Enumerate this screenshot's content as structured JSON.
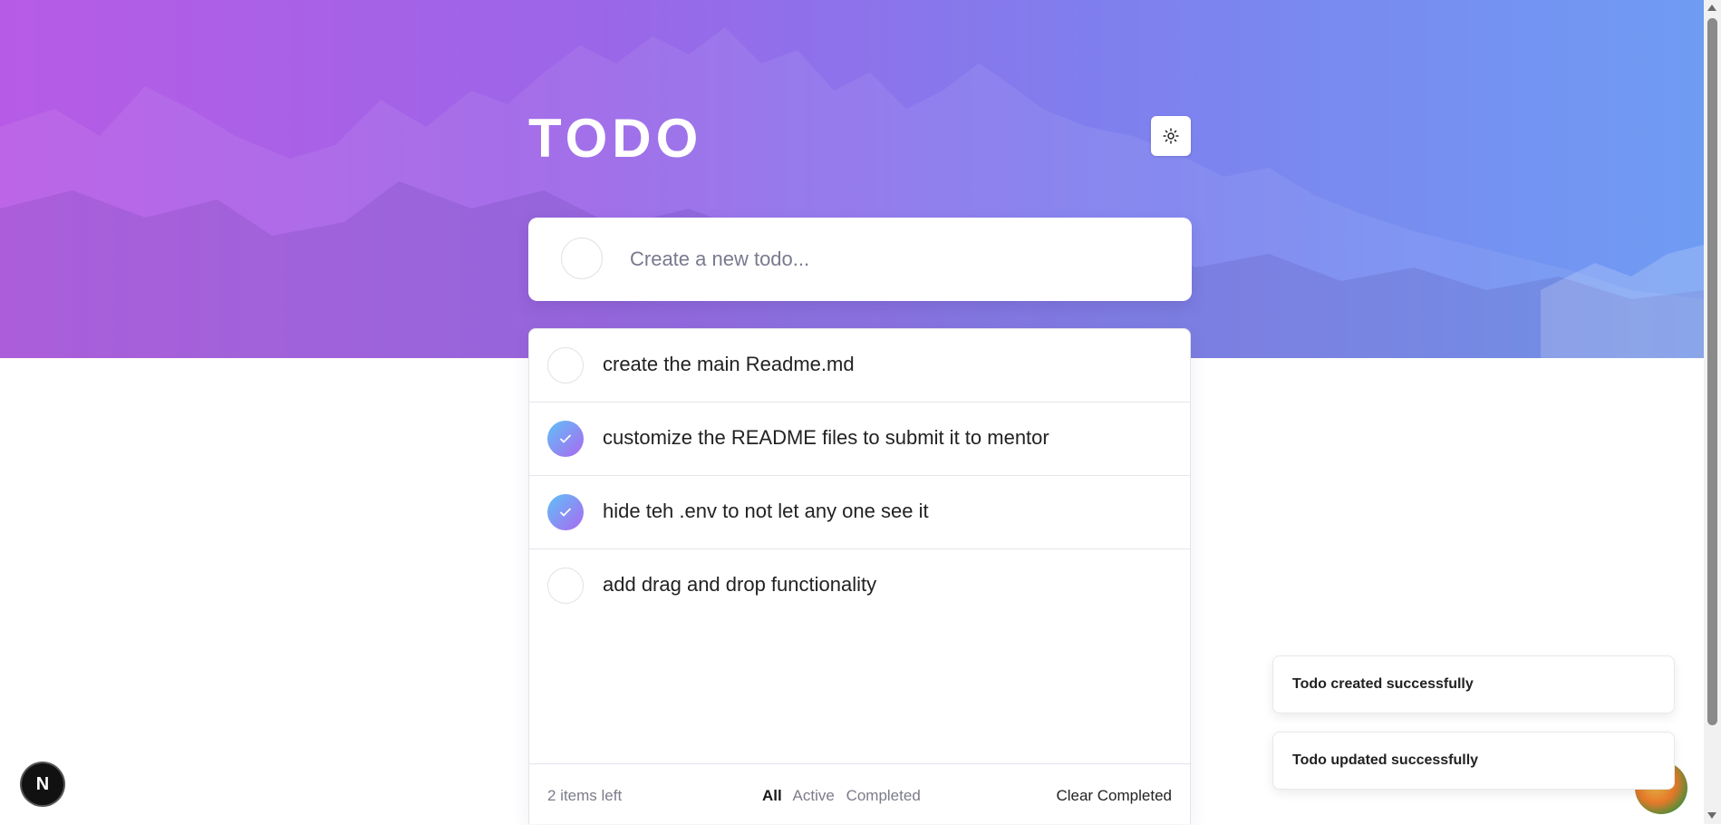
{
  "app": {
    "title": "TODO",
    "theme_toggle_icon": "sun-icon"
  },
  "create": {
    "placeholder": "Create a new todo...",
    "value": ""
  },
  "todos": [
    {
      "text": "create the main Readme.md",
      "completed": false
    },
    {
      "text": "customize the README files to submit it to mentor",
      "completed": true
    },
    {
      "text": "hide teh .env to not let any one see it",
      "completed": true
    },
    {
      "text": "add drag and drop functionality",
      "completed": false
    }
  ],
  "footer": {
    "items_left": "2 items left",
    "filters": [
      "All",
      "Active",
      "Completed"
    ],
    "active_filter": "All",
    "clear_label": "Clear Completed"
  },
  "toasts": [
    "Todo created successfully",
    "Todo updated successfully"
  ],
  "badge": {
    "label": "N"
  },
  "colors": {
    "gradient_start": "#b75be6",
    "gradient_end": "#6f9cf3",
    "check_start": "#5fc0f7",
    "check_end": "#ab68f0"
  }
}
